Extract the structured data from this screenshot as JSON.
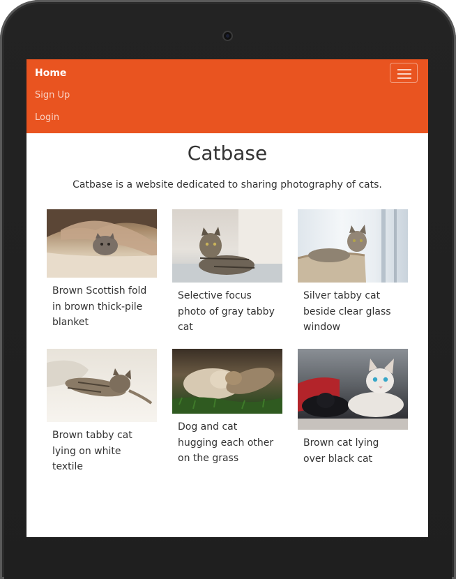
{
  "navbar": {
    "home": "Home",
    "signup": "Sign Up",
    "login": "Login",
    "toggler_icon": "hamburger-icon",
    "brand_color": "#e95420"
  },
  "main": {
    "title": "Catbase",
    "lead": "Catbase is a website dedicated to sharing photography of cats."
  },
  "gallery": [
    {
      "caption": "Brown Scottish fold in brown thick-pile blanket"
    },
    {
      "caption": "Selective focus photo of gray tabby cat"
    },
    {
      "caption": "Silver tabby cat beside clear glass window"
    },
    {
      "caption": "Brown tabby cat lying on white textile"
    },
    {
      "caption": "Dog and cat hugging each other on the grass"
    },
    {
      "caption": "Brown cat lying over black cat"
    }
  ]
}
